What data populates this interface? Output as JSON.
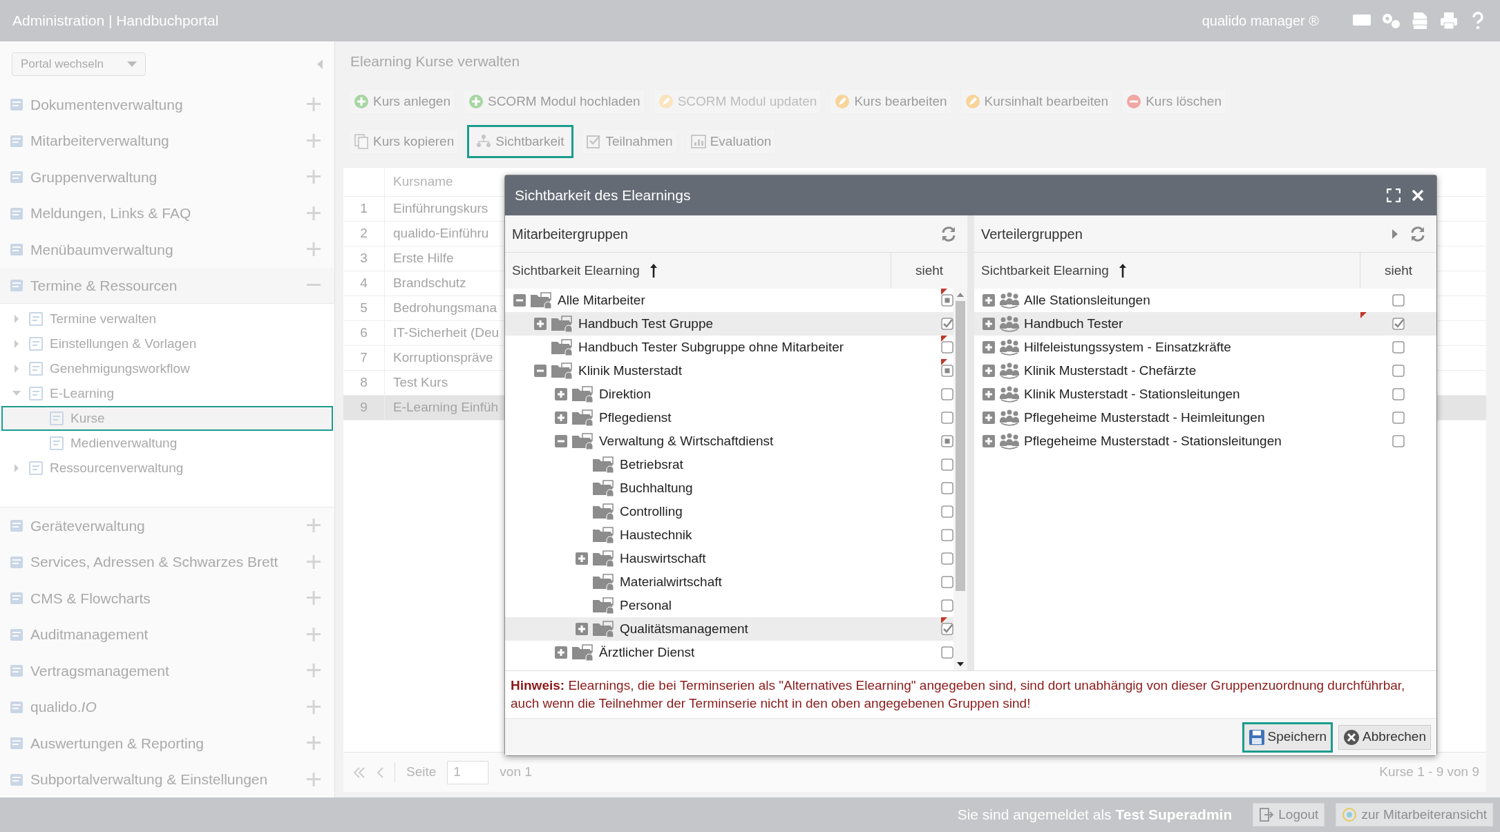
{
  "topbar": {
    "title": "Administration | Handbuchportal",
    "product": "qualido manager ®"
  },
  "sidebar": {
    "portal_select": "Portal wechseln",
    "items": [
      {
        "label": "Dokumentenverwaltung",
        "expanded": false
      },
      {
        "label": "Mitarbeiterverwaltung",
        "expanded": false
      },
      {
        "label": "Gruppenverwaltung",
        "expanded": false
      },
      {
        "label": "Meldungen, Links & FAQ",
        "expanded": false
      },
      {
        "label": "Menübaumverwaltung",
        "expanded": false
      },
      {
        "label": "Termine & Ressourcen",
        "expanded": true,
        "children": [
          {
            "label": "Termine verwalten",
            "expanded": false,
            "selected": false
          },
          {
            "label": "Einstellungen & Vorlagen",
            "expanded": false,
            "selected": false
          },
          {
            "label": "Genehmigungsworkflow",
            "expanded": false,
            "selected": false
          },
          {
            "label": "E-Learning",
            "expanded": true,
            "selected": false,
            "children": [
              {
                "label": "Kurse",
                "selected": true
              },
              {
                "label": "Medienverwaltung",
                "selected": false
              }
            ]
          },
          {
            "label": "Ressourcenverwaltung",
            "expanded": false,
            "selected": false
          }
        ]
      },
      {
        "label": "Geräteverwaltung",
        "expanded": false
      },
      {
        "label": "Services, Adressen & Schwarzes Brett",
        "expanded": false
      },
      {
        "label": "CMS & Flowcharts",
        "expanded": false
      },
      {
        "label": "Auditmanagement",
        "expanded": false
      },
      {
        "label": "Vertragsmanagement",
        "expanded": false
      },
      {
        "label": "qualido.*IO*",
        "expanded": false
      },
      {
        "label": "Auswertungen & Reporting",
        "expanded": false
      },
      {
        "label": "Subportalverwaltung & Einstellungen",
        "expanded": false
      }
    ]
  },
  "main": {
    "title": "Elearning Kurse verwalten",
    "toolbar_rows": [
      [
        {
          "label": "Kurs anlegen",
          "disabled": false,
          "selected": false
        },
        {
          "label": "SCORM Modul hochladen",
          "disabled": false,
          "selected": false
        },
        {
          "label": "SCORM Modul updaten",
          "disabled": true,
          "selected": false
        },
        {
          "label": "Kurs bearbeiten",
          "disabled": false,
          "selected": false
        },
        {
          "label": "Kursinhalt bearbeiten",
          "disabled": false,
          "selected": false
        },
        {
          "label": "Kurs löschen",
          "disabled": false,
          "selected": false
        }
      ],
      [
        {
          "label": "Kurs kopieren",
          "disabled": false,
          "selected": false
        },
        {
          "label": "Sichtbarkeit",
          "disabled": false,
          "selected": true
        },
        {
          "label": "Teilnahmen",
          "disabled": false,
          "selected": false
        },
        {
          "label": "Evaluation",
          "disabled": false,
          "selected": false
        }
      ]
    ],
    "table": {
      "columns": [
        "Kursname"
      ],
      "rows": [
        {
          "number": "1",
          "name": "Einführungskurs",
          "selected": false
        },
        {
          "number": "2",
          "name": "qualido-Einführu",
          "selected": false
        },
        {
          "number": "3",
          "name": "Erste Hilfe",
          "selected": false
        },
        {
          "number": "4",
          "name": "Brandschutz",
          "selected": false
        },
        {
          "number": "5",
          "name": "Bedrohungsmana",
          "selected": false
        },
        {
          "number": "6",
          "name": "IT-Sicherheit (Deu",
          "selected": false
        },
        {
          "number": "7",
          "name": "Korruptionspräve",
          "selected": false
        },
        {
          "number": "8",
          "name": "Test Kurs",
          "selected": false
        },
        {
          "number": "9",
          "name": "E-Learning Einfüh",
          "selected": true
        }
      ]
    },
    "pager": {
      "page_label": "Seite",
      "page": "1",
      "page_count": "von 1",
      "summary": "Kurse 1 - 9 von 9"
    }
  },
  "dialog": {
    "title": "Sichtbarkeit des Elearnings",
    "panels": [
      {
        "title": "Mitarbeitergruppen",
        "column_name": "Sichtbarkeit Elearning",
        "column_check": "sieht",
        "rows": [
          {
            "label": "Alle Mitarbeiter",
            "kind": "node",
            "expanded": true,
            "checked": false,
            "partial": true,
            "marked": true,
            "highlighted": false,
            "children": [
              {
                "label": "Handbuch Test Gruppe",
                "kind": "node",
                "expanded": false,
                "checked": true,
                "partial": false,
                "marked": false,
                "highlighted": true
              },
              {
                "label": "Handbuch Tester Subgruppe ohne Mitarbeiter",
                "kind": "leaf",
                "checked": false,
                "partial": false,
                "marked": true,
                "highlighted": false
              },
              {
                "label": "Klinik Musterstadt",
                "kind": "node",
                "expanded": true,
                "checked": false,
                "partial": true,
                "marked": true,
                "highlighted": false,
                "children": [
                  {
                    "label": "Direktion",
                    "kind": "node",
                    "expanded": false,
                    "checked": false,
                    "partial": false,
                    "marked": false,
                    "highlighted": false
                  },
                  {
                    "label": "Pflegedienst",
                    "kind": "node",
                    "expanded": false,
                    "checked": false,
                    "partial": false,
                    "marked": false,
                    "highlighted": false
                  },
                  {
                    "label": "Verwaltung & Wirtschaftdienst",
                    "kind": "node",
                    "expanded": true,
                    "checked": false,
                    "partial": true,
                    "marked": false,
                    "highlighted": false,
                    "children": [
                      {
                        "label": "Betriebsrat",
                        "kind": "leaf",
                        "checked": false,
                        "partial": false,
                        "marked": false,
                        "highlighted": false
                      },
                      {
                        "label": "Buchhaltung",
                        "kind": "leaf",
                        "checked": false,
                        "partial": false,
                        "marked": false,
                        "highlighted": false
                      },
                      {
                        "label": "Controlling",
                        "kind": "leaf",
                        "checked": false,
                        "partial": false,
                        "marked": false,
                        "highlighted": false
                      },
                      {
                        "label": "Haustechnik",
                        "kind": "leaf",
                        "checked": false,
                        "partial": false,
                        "marked": false,
                        "highlighted": false
                      },
                      {
                        "label": "Hauswirtschaft",
                        "kind": "node",
                        "expanded": false,
                        "checked": false,
                        "partial": false,
                        "marked": false,
                        "highlighted": false
                      },
                      {
                        "label": "Materialwirtschaft",
                        "kind": "leaf",
                        "checked": false,
                        "partial": false,
                        "marked": false,
                        "highlighted": false
                      },
                      {
                        "label": "Personal",
                        "kind": "leaf",
                        "checked": false,
                        "partial": false,
                        "marked": false,
                        "highlighted": false
                      },
                      {
                        "label": "Qualitätsmanagement",
                        "kind": "node",
                        "expanded": false,
                        "checked": true,
                        "partial": false,
                        "marked": true,
                        "highlighted": true
                      }
                    ]
                  },
                  {
                    "label": "Ärztlicher Dienst",
                    "kind": "node",
                    "expanded": false,
                    "checked": false,
                    "partial": false,
                    "marked": false,
                    "highlighted": false
                  }
                ]
              }
            ]
          }
        ]
      },
      {
        "title": "Verteilergruppen",
        "column_name": "Sichtbarkeit Elearning",
        "column_check": "sieht",
        "rows": [
          {
            "label": "Alle Stationsleitungen",
            "kind": "node",
            "expanded": false,
            "checked": false,
            "partial": false,
            "marked": false,
            "highlighted": false
          },
          {
            "label": "Handbuch Tester",
            "kind": "node",
            "expanded": false,
            "checked": true,
            "partial": false,
            "marked": true,
            "highlighted": true
          },
          {
            "label": "Hilfeleistungssystem - Einsatzkräfte",
            "kind": "node",
            "expanded": false,
            "checked": false,
            "partial": false,
            "marked": false,
            "highlighted": false
          },
          {
            "label": "Klinik Musterstadt - Chefärzte",
            "kind": "node",
            "expanded": false,
            "checked": false,
            "partial": false,
            "marked": false,
            "highlighted": false
          },
          {
            "label": "Klinik Musterstadt - Stationsleitungen",
            "kind": "node",
            "expanded": false,
            "checked": false,
            "partial": false,
            "marked": false,
            "highlighted": false
          },
          {
            "label": "Pflegeheime Musterstadt - Heimleitungen",
            "kind": "node",
            "expanded": false,
            "checked": false,
            "partial": false,
            "marked": false,
            "highlighted": false
          },
          {
            "label": "Pflegeheime Musterstadt - Stationsleitungen",
            "kind": "node",
            "expanded": false,
            "checked": false,
            "partial": false,
            "marked": false,
            "highlighted": false
          }
        ]
      }
    ],
    "notice": "**Hinweis:** Elearnings, die bei Terminserien als \"Alternatives Elearning\" angegeben sind, sind dort unabhängig von dieser Gruppenzuordnung durchführbar, auch wenn die Teilnehmer der Terminserie nicht in den oben angegebenen Gruppen sind!",
    "buttons": [
      {
        "label": "Speichern",
        "selected": true
      },
      {
        "label": "Abbrechen",
        "selected": false
      }
    ]
  },
  "status_bar": {
    "login": "Sie sind angemeldet als **Test Superadmin**",
    "buttons": [
      "Logout",
      "zur Mitarbeiteransicht"
    ]
  }
}
